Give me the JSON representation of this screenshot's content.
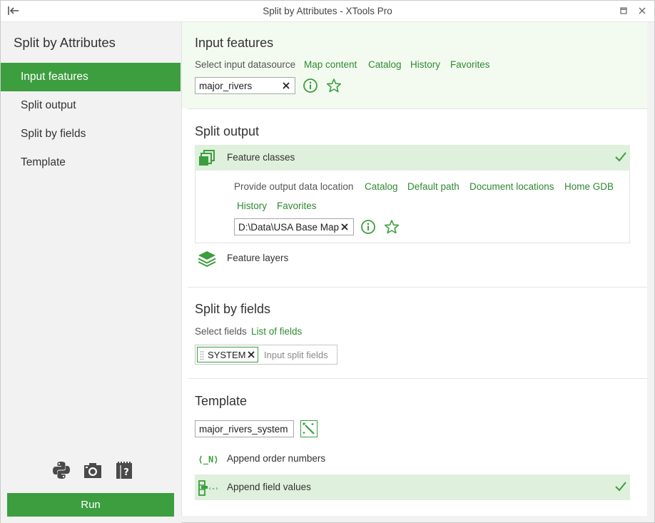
{
  "window": {
    "title": "Split by Attributes - XTools Pro"
  },
  "sidebar": {
    "title": "Split by Attributes",
    "items": [
      {
        "label": "Input features",
        "active": true
      },
      {
        "label": "Split output",
        "active": false
      },
      {
        "label": "Split by fields",
        "active": false
      },
      {
        "label": "Template",
        "active": false
      }
    ],
    "tools": [
      "python-icon",
      "camera-icon",
      "help-book-icon"
    ],
    "run_label": "Run"
  },
  "input_features": {
    "title": "Input features",
    "select_label": "Select input datasource",
    "links": [
      "Map content",
      "Catalog",
      "History",
      "Favorites"
    ],
    "value": "major_rivers"
  },
  "split_output": {
    "title": "Split output",
    "feature_classes_label": "Feature classes",
    "location_label": "Provide output data location",
    "links": [
      "Catalog",
      "Default path",
      "Document locations",
      "Home GDB",
      "History",
      "Favorites"
    ],
    "path_value": "D:\\Data\\USA Base Map",
    "feature_layers_label": "Feature layers"
  },
  "split_by_fields": {
    "title": "Split by fields",
    "select_label": "Select fields",
    "list_link": "List of fields",
    "tag": "SYSTEM",
    "placeholder": "Input split fields"
  },
  "template": {
    "title": "Template",
    "value": "major_rivers_system",
    "append_order_label": "Append order numbers",
    "append_field_label": "Append field values"
  },
  "colors": {
    "accent": "#3c9e3f",
    "link": "#2e8a2f",
    "selected_row": "#dff0dc",
    "highlight_section": "#f3fbf1"
  }
}
